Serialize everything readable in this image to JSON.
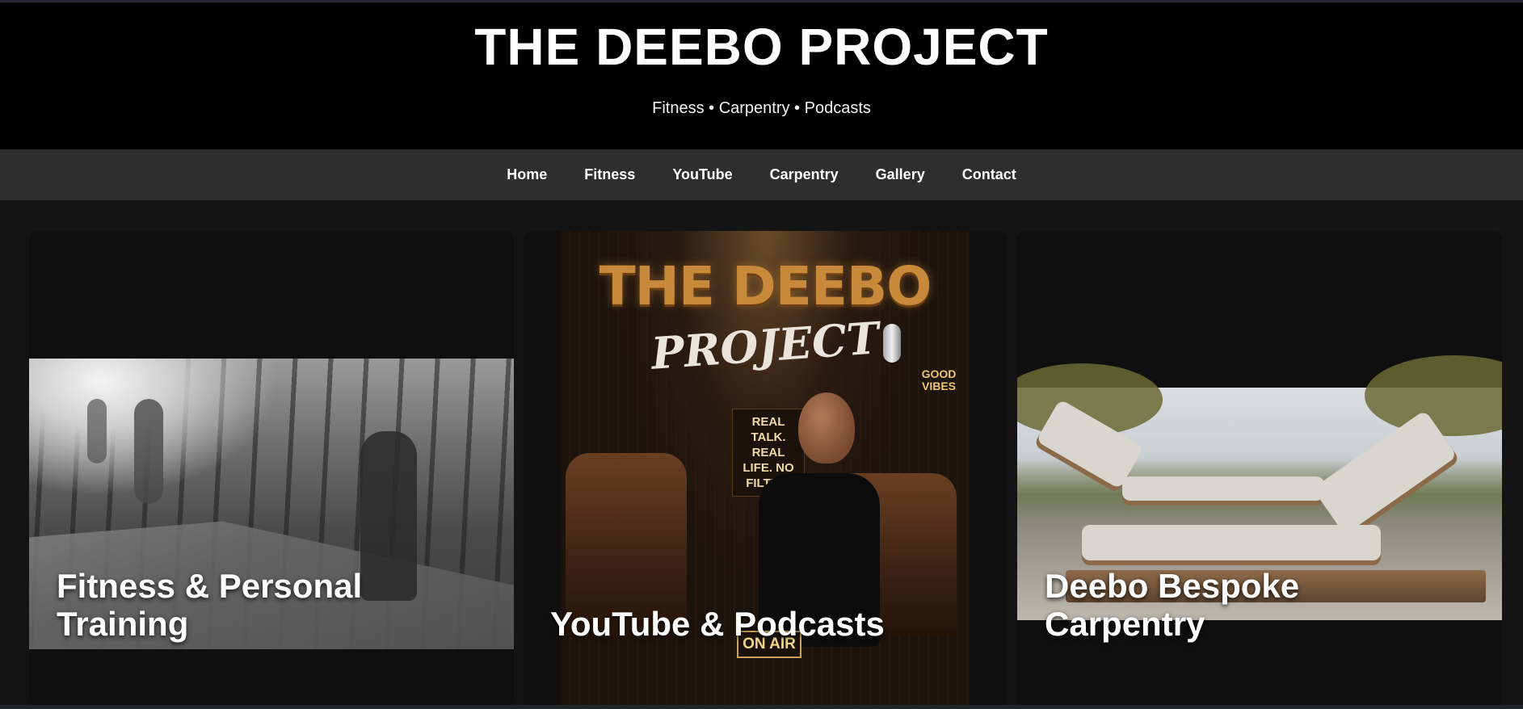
{
  "site": {
    "title": "THE DEEBO PROJECT",
    "tagline": "Fitness • Carpentry • Podcasts"
  },
  "nav": {
    "items": [
      {
        "label": "Home"
      },
      {
        "label": "Fitness"
      },
      {
        "label": "YouTube"
      },
      {
        "label": "Carpentry"
      },
      {
        "label": "Gallery"
      },
      {
        "label": "Contact"
      }
    ]
  },
  "cards": {
    "fitness": {
      "label_line1": "Fitness & Personal",
      "label_line2": "Training"
    },
    "youtube": {
      "label": "YouTube & Podcasts",
      "poster_title": "THE DEEBO",
      "poster_subtitle": "PROJECT",
      "poster_sign": "REAL TALK. REAL LIFE. NO FILTER.",
      "poster_vibes": "GOOD VIBES",
      "poster_onair": "ON AIR"
    },
    "carpentry": {
      "label_line1": "Deebo Bespoke",
      "label_line2": "Carpentry"
    }
  },
  "colors": {
    "header_bg": "#000000",
    "nav_bg": "#2e2e2e",
    "page_bg": "#141414",
    "card_bg": "#0f0f0f",
    "poster_gold": "#c88a3a"
  }
}
